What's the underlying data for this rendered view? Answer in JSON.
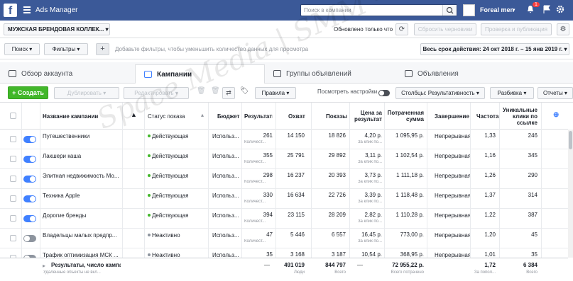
{
  "app": {
    "logo": "f",
    "title": "Ads Manager",
    "search_placeholder": "Поиск в компании",
    "account_name": "Foreal men",
    "notif_count": "1"
  },
  "account_bar": {
    "account": "МУЖСКАЯ БРЕНДОВАЯ КОЛЛЕК... ▾",
    "updated": "Обновлено только что",
    "discard": "Сбросить черновики",
    "review": "Проверка и публикация"
  },
  "filter_bar": {
    "search": "Поиск ▾",
    "filters": "Фильтры ▾",
    "add": "+",
    "placeholder": "Добавьте фильтры, чтобы уменьшить количество данных для просмотра",
    "date_range": "Весь срок действия: 24 окт 2018 г. – 15 янв 2019 г. ▾"
  },
  "tabs": [
    {
      "label": "Обзор аккаунта"
    },
    {
      "label": "Кампании"
    },
    {
      "label": "Группы объявлений"
    },
    {
      "label": "Объявления"
    }
  ],
  "toolbar": {
    "create": "+ Создать",
    "duplicate": "Дублировать ▾",
    "edit": "Редактировать ▾",
    "rules": "Правила ▾",
    "view_setup": "Посмотреть настройки",
    "columns": "Столбцы: Результативность ▾",
    "breakdown": "Разбивка ▾",
    "reports": "Отчеты ▾"
  },
  "columns": {
    "name": "Название кампании",
    "status": "Статус показа",
    "budget": "Бюджет",
    "results": "Результаты",
    "reach": "Охват",
    "impressions": "Показы",
    "cpr": "Цена за результат",
    "spent": "Потраченная сумма",
    "ends": "Завершение",
    "frequency": "Частота",
    "clicks": "Уникальные клики по ссылке"
  },
  "rows": [
    {
      "name": "Путешественники",
      "status": "Действующая",
      "status_color": "#42b72a",
      "on": true,
      "budget": "Использ...",
      "results": "261",
      "results_sub": "Количест...",
      "reach": "14 150",
      "impr": "18 826",
      "cpr": "4,20 р.",
      "cpr_sub": "За клик по...",
      "spent": "1 095,95 р.",
      "ends": "Непрерывная",
      "freq": "1,33",
      "clicks": "246"
    },
    {
      "name": "Лакшери каша",
      "status": "Действующая",
      "status_color": "#42b72a",
      "on": true,
      "budget": "Использ...",
      "results": "355",
      "results_sub": "Количест...",
      "reach": "25 791",
      "impr": "29 892",
      "cpr": "3,11 р.",
      "cpr_sub": "За клик по...",
      "spent": "1 102,54 р.",
      "ends": "Непрерывная",
      "freq": "1,16",
      "clicks": "345"
    },
    {
      "name": "Элитная недвижимость Мо...",
      "status": "Действующая",
      "status_color": "#42b72a",
      "on": true,
      "budget": "Использ...",
      "results": "298",
      "results_sub": "Количест...",
      "reach": "16 237",
      "impr": "20 393",
      "cpr": "3,73 р.",
      "cpr_sub": "За клик по...",
      "spent": "1 111,18 р.",
      "ends": "Непрерывная",
      "freq": "1,26",
      "clicks": "290"
    },
    {
      "name": "Техника Apple",
      "status": "Действующая",
      "status_color": "#42b72a",
      "on": true,
      "budget": "Использ...",
      "results": "330",
      "results_sub": "Количест...",
      "reach": "16 634",
      "impr": "22 726",
      "cpr": "3,39 р.",
      "cpr_sub": "За клик по...",
      "spent": "1 118,48 р.",
      "ends": "Непрерывная",
      "freq": "1,37",
      "clicks": "314"
    },
    {
      "name": "Дорогие бренды",
      "status": "Действующая",
      "status_color": "#42b72a",
      "on": true,
      "budget": "Использ...",
      "results": "394",
      "results_sub": "Количест...",
      "reach": "23 115",
      "impr": "28 209",
      "cpr": "2,82 р.",
      "cpr_sub": "За клик по...",
      "spent": "1 110,28 р.",
      "ends": "Непрерывная",
      "freq": "1,22",
      "clicks": "387"
    },
    {
      "name": "Владельцы малых предпр...",
      "status": "Неактивно",
      "status_color": "#8d949e",
      "on": false,
      "budget": "Использ...",
      "results": "47",
      "results_sub": "Количест...",
      "reach": "5 446",
      "impr": "6 557",
      "cpr": "16,45 р.",
      "cpr_sub": "За клик по...",
      "spent": "773,00 р.",
      "ends": "Непрерывная",
      "freq": "1,20",
      "clicks": "45"
    },
    {
      "name": "Трафик оптимизация МСК ...",
      "status": "Неактивно",
      "status_color": "#8d949e",
      "on": false,
      "budget": "Использ...",
      "results": "35",
      "results_sub": "Количест...",
      "reach": "3 168",
      "impr": "3 187",
      "cpr": "10,54 р.",
      "cpr_sub": "За клик по...",
      "spent": "368,95 р.",
      "ends": "Непрерывная",
      "freq": "1,01",
      "clicks": "35"
    }
  ],
  "footer": {
    "label": "Результаты, число кампа",
    "sub": "Удаленные объекты не вкл...",
    "results": "—",
    "reach": "491 019",
    "reach_sub": "Люди",
    "impr": "844 797",
    "impr_sub": "Всего",
    "cpr": "—",
    "spent": "72 955,22 р.",
    "spent_sub": "Всего потрачено",
    "freq": "1,72",
    "freq_sub": "За попол...",
    "clicks": "6 384",
    "clicks_sub": "Всего"
  },
  "watermark": "Space Media | SMM - агентство"
}
